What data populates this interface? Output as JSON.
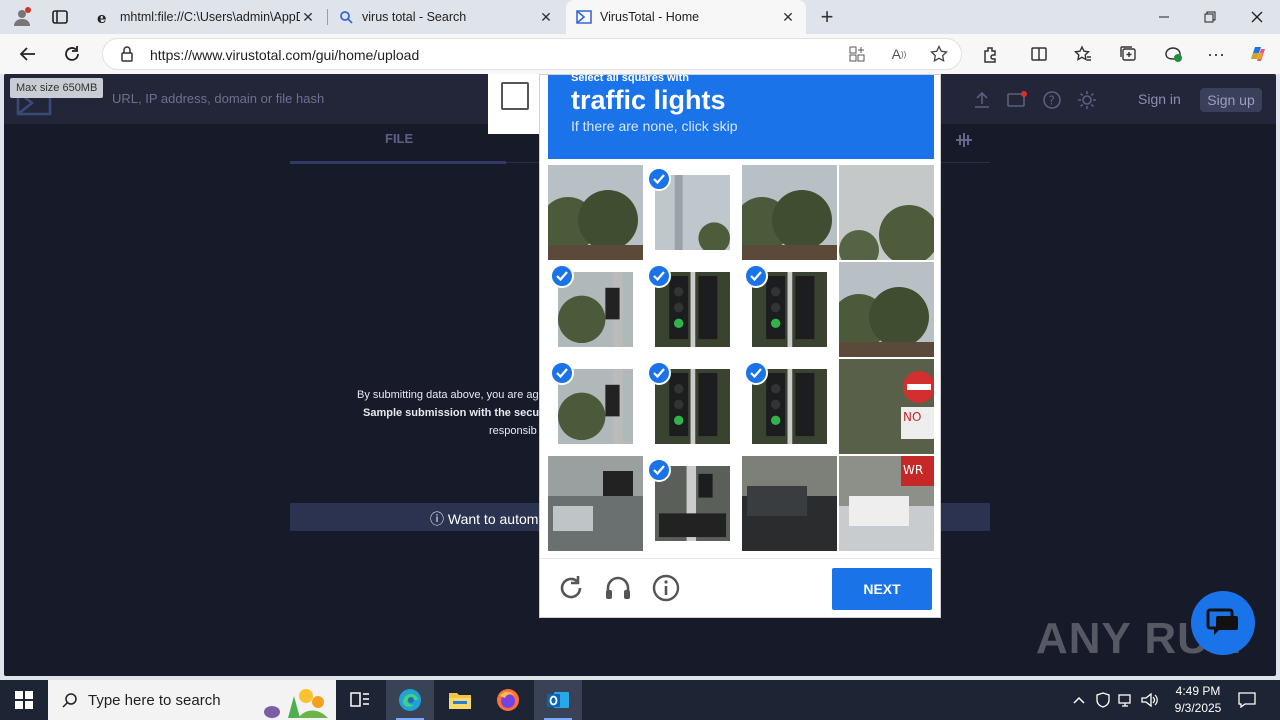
{
  "browser": {
    "tabs": [
      {
        "title": "mhtml:file://C:\\Users\\admin\\AppD",
        "active": false
      },
      {
        "title": "virus total - Search",
        "active": false
      },
      {
        "title": "VirusTotal - Home",
        "active": true
      }
    ],
    "url": "https://www.virustotal.com/gui/home/upload"
  },
  "vt": {
    "tooltip": "Max size 650MB",
    "search_placeholder": "URL, IP address, domain or file hash",
    "sign_in": "Sign in",
    "sign_up": "Sign up",
    "file_tab": "FILE",
    "disclaimer_1": "By submitting data above, you are ag",
    "disclaimer_2": "Sample submission with the secu",
    "disclaimer_3": "responsib",
    "want_bar": "ⓘ Want to automa"
  },
  "captcha": {
    "select_text": "Select all squares with",
    "target": "traffic lights",
    "hint": "If there are none, click skip",
    "next_label": "NEXT",
    "cells": [
      {
        "selected": false,
        "scene": "trees"
      },
      {
        "selected": true,
        "scene": "pole"
      },
      {
        "selected": false,
        "scene": "trees"
      },
      {
        "selected": false,
        "scene": "sky-trees"
      },
      {
        "selected": true,
        "scene": "light-pole"
      },
      {
        "selected": true,
        "scene": "traffic-light"
      },
      {
        "selected": true,
        "scene": "traffic-light"
      },
      {
        "selected": false,
        "scene": "trees"
      },
      {
        "selected": true,
        "scene": "light-pole"
      },
      {
        "selected": true,
        "scene": "traffic-light"
      },
      {
        "selected": true,
        "scene": "traffic-light"
      },
      {
        "selected": false,
        "scene": "no-entry-sign"
      },
      {
        "selected": false,
        "scene": "street"
      },
      {
        "selected": true,
        "scene": "pole-car"
      },
      {
        "selected": false,
        "scene": "cars"
      },
      {
        "selected": false,
        "scene": "wrong-way-sign"
      }
    ]
  },
  "watermark": "ANY RUN",
  "taskbar": {
    "search_placeholder": "Type here to search",
    "time": "4:49 PM",
    "date": "9/3/2025"
  },
  "colors": {
    "captcha_blue": "#1a73e8",
    "vt_bg": "#171a29",
    "vt_header": "#222638"
  }
}
